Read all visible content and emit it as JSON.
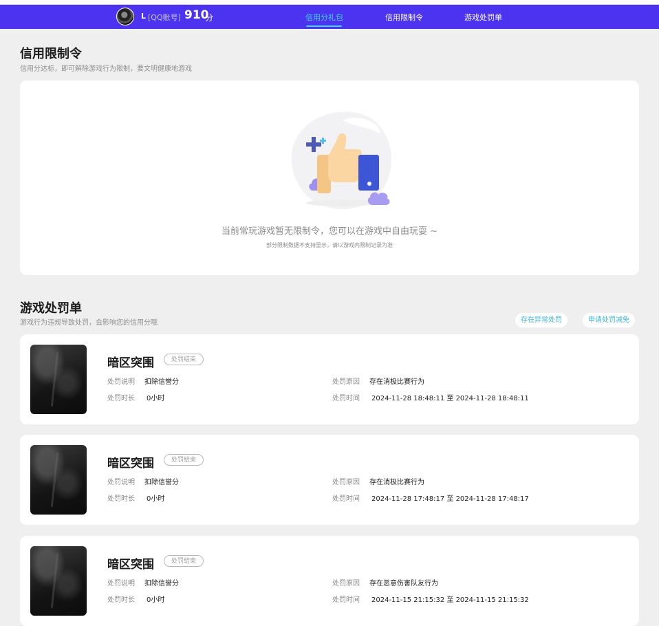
{
  "header": {
    "user_name": "L",
    "account_type": "[QQ账号]",
    "score": "910",
    "score_unit": "分",
    "tabs": [
      {
        "label": "信用分礼包",
        "active": true
      },
      {
        "label": "信用限制令",
        "active": false
      },
      {
        "label": "游戏处罚单",
        "active": false
      }
    ]
  },
  "restriction": {
    "title": "信用限制令",
    "subtitle": "信用分达标，即可解除游戏行为限制，要文明健康地游戏",
    "empty_message": "当前常玩游戏暂无限制令，您可以在游戏中自由玩耍 ~",
    "empty_note": "部分限制数据不支持显示，请以游戏内限制记录为准"
  },
  "penalty": {
    "title": "游戏处罚单",
    "subtitle": "游戏行为违规导致处罚，会影响您的信用分哦",
    "appeal_abnormal": "存在异常处罚",
    "apply_reduction": "申请处罚减免",
    "labels": {
      "desc": "处罚说明",
      "duration": "处罚时长",
      "reason": "处罚原因",
      "time": "处罚时间"
    },
    "records": [
      {
        "game": "暗区突围",
        "status": "处罚结束",
        "desc": "扣除信誉分",
        "duration": "0小时",
        "reason": "存在消极比赛行为",
        "time": "2024-11-28 18:48:11 至 2024-11-28 18:48:11"
      },
      {
        "game": "暗区突围",
        "status": "处罚结束",
        "desc": "扣除信誉分",
        "duration": "0小时",
        "reason": "存在消极比赛行为",
        "time": "2024-11-28 17:48:17 至 2024-11-28 17:48:17"
      },
      {
        "game": "暗区突围",
        "status": "处罚结束",
        "desc": "扣除信誉分",
        "duration": "0小时",
        "reason": "存在恶意伤害队友行为",
        "time": "2024-11-15 21:15:32 至 2024-11-15 21:15:32"
      }
    ]
  },
  "colors": {
    "nav_bg": "#4b33f0",
    "tab_active": "#3fd5f5",
    "link_blue": "#3ab8dc"
  }
}
